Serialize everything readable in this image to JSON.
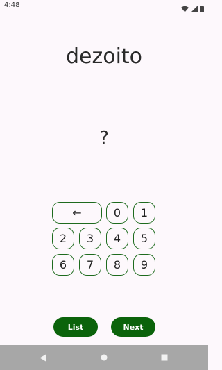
{
  "status_bar": {
    "time": "4:48",
    "icons": [
      "wifi-icon",
      "signal-icon",
      "battery-icon"
    ]
  },
  "quiz": {
    "word": "dezoito",
    "answer": "?"
  },
  "keypad": {
    "backspace_label": "←",
    "digits": {
      "d0": "0",
      "d1": "1",
      "d2": "2",
      "d3": "3",
      "d4": "4",
      "d5": "5",
      "d6": "6",
      "d7": "7",
      "d8": "8",
      "d9": "9"
    }
  },
  "actions": {
    "list_label": "List",
    "next_label": "Next"
  },
  "nav_bar": {
    "icons": [
      "back-icon",
      "home-icon",
      "recents-icon"
    ]
  },
  "colors": {
    "background": "#fdf8fc",
    "accent": "#0b630b",
    "key_border": "#1e6b1e",
    "nav_bar": "#a7a7a7"
  }
}
